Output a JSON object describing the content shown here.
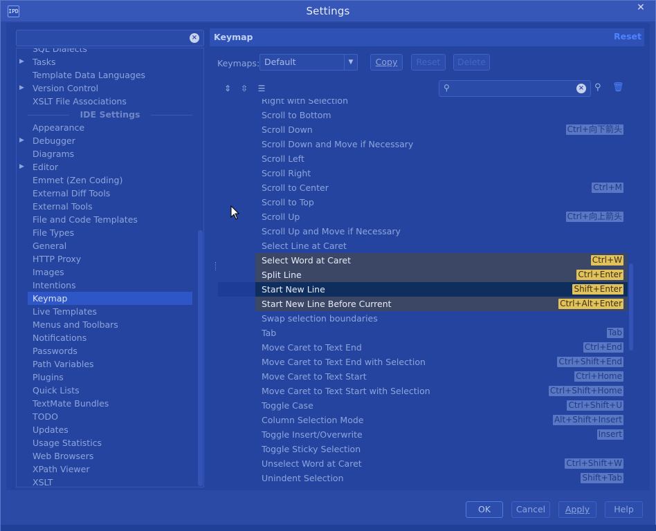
{
  "window": {
    "title": "Settings",
    "app_icon_text": "IPD"
  },
  "left": {
    "search_value": "",
    "tree": [
      {
        "label": "SQL Dialects",
        "arrow": false
      },
      {
        "label": "Tasks",
        "arrow": true
      },
      {
        "label": "Template Data Languages",
        "arrow": false
      },
      {
        "label": "Version Control",
        "arrow": true
      },
      {
        "label": "XSLT File Associations",
        "arrow": false
      },
      {
        "label": "IDE Settings",
        "header": true
      },
      {
        "label": "Appearance",
        "arrow": false
      },
      {
        "label": "Debugger",
        "arrow": true
      },
      {
        "label": "Diagrams",
        "arrow": false
      },
      {
        "label": "Editor",
        "arrow": true
      },
      {
        "label": "Emmet (Zen Coding)",
        "arrow": false
      },
      {
        "label": "External Diff Tools",
        "arrow": false
      },
      {
        "label": "External Tools",
        "arrow": false
      },
      {
        "label": "File and Code Templates",
        "arrow": false
      },
      {
        "label": "File Types",
        "arrow": false
      },
      {
        "label": "General",
        "arrow": false
      },
      {
        "label": "HTTP Proxy",
        "arrow": false
      },
      {
        "label": "Images",
        "arrow": false
      },
      {
        "label": "Intentions",
        "arrow": false
      },
      {
        "label": "Keymap",
        "arrow": false,
        "selected": true
      },
      {
        "label": "Live Templates",
        "arrow": false
      },
      {
        "label": "Menus and Toolbars",
        "arrow": false
      },
      {
        "label": "Notifications",
        "arrow": false
      },
      {
        "label": "Passwords",
        "arrow": false
      },
      {
        "label": "Path Variables",
        "arrow": false
      },
      {
        "label": "Plugins",
        "arrow": false
      },
      {
        "label": "Quick Lists",
        "arrow": false
      },
      {
        "label": "TextMate Bundles",
        "arrow": false
      },
      {
        "label": "TODO",
        "arrow": false
      },
      {
        "label": "Updates",
        "arrow": false
      },
      {
        "label": "Usage Statistics",
        "arrow": false
      },
      {
        "label": "Web Browsers",
        "arrow": false
      },
      {
        "label": "XPath Viewer",
        "arrow": false
      },
      {
        "label": "XSLT",
        "arrow": false
      }
    ]
  },
  "right": {
    "title": "Keymap",
    "reset_label": "Reset",
    "keymaps_label": "Keymaps:",
    "keymap_selected": "Default",
    "copy_label": "Copy",
    "reset_btn_label": "Reset",
    "delete_label": "Delete",
    "find_value": "",
    "actions": [
      {
        "name": "Right with Selection",
        "key": ""
      },
      {
        "name": "Scroll to Bottom",
        "key": ""
      },
      {
        "name": "Scroll Down",
        "key": "Ctrl+向下箭头"
      },
      {
        "name": "Scroll Down and Move if Necessary",
        "key": ""
      },
      {
        "name": "Scroll Left",
        "key": ""
      },
      {
        "name": "Scroll Right",
        "key": ""
      },
      {
        "name": "Scroll to Center",
        "key": "Ctrl+M"
      },
      {
        "name": "Scroll to Top",
        "key": ""
      },
      {
        "name": "Scroll Up",
        "key": "Ctrl+向上箭头"
      },
      {
        "name": "Scroll Up and Move if Necessary",
        "key": ""
      },
      {
        "name": "Select Line at Caret",
        "key": ""
      },
      {
        "name": "Select Word at Caret",
        "key": "Ctrl+W",
        "hl": true
      },
      {
        "name": "Split Line",
        "key": "Ctrl+Enter",
        "hl": true
      },
      {
        "name": "Start New Line",
        "key": "Shift+Enter",
        "hl": true,
        "selected": true
      },
      {
        "name": "Start New Line Before Current",
        "key": "Ctrl+Alt+Enter",
        "hl": true
      },
      {
        "name": "Swap selection boundaries",
        "key": ""
      },
      {
        "name": "Tab",
        "key": "Tab"
      },
      {
        "name": "Move Caret to Text End",
        "key": "Ctrl+End"
      },
      {
        "name": "Move Caret to Text End with Selection",
        "key": "Ctrl+Shift+End"
      },
      {
        "name": "Move Caret to Text Start",
        "key": "Ctrl+Home"
      },
      {
        "name": "Move Caret to Text Start with Selection",
        "key": "Ctrl+Shift+Home"
      },
      {
        "name": "Toggle Case",
        "key": "Ctrl+Shift+U"
      },
      {
        "name": "Column Selection Mode",
        "key": "Alt+Shift+Insert"
      },
      {
        "name": "Toggle Insert/Overwrite",
        "key": "Insert"
      },
      {
        "name": "Toggle Sticky Selection",
        "key": ""
      },
      {
        "name": "Unselect Word at Caret",
        "key": "Ctrl+Shift+W"
      },
      {
        "name": "Unindent Selection",
        "key": "Shift+Tab"
      }
    ]
  },
  "footer": {
    "ok_label": "OK",
    "cancel_label": "Cancel",
    "apply_label": "Apply",
    "help_label": "Help"
  },
  "colors": {
    "background": "#2a4aa6",
    "selection": "#2f56c6",
    "highlight_row": "#3c4766",
    "shortcut_highlight": "#e2c25b",
    "reset_link": "#4f82ff"
  }
}
